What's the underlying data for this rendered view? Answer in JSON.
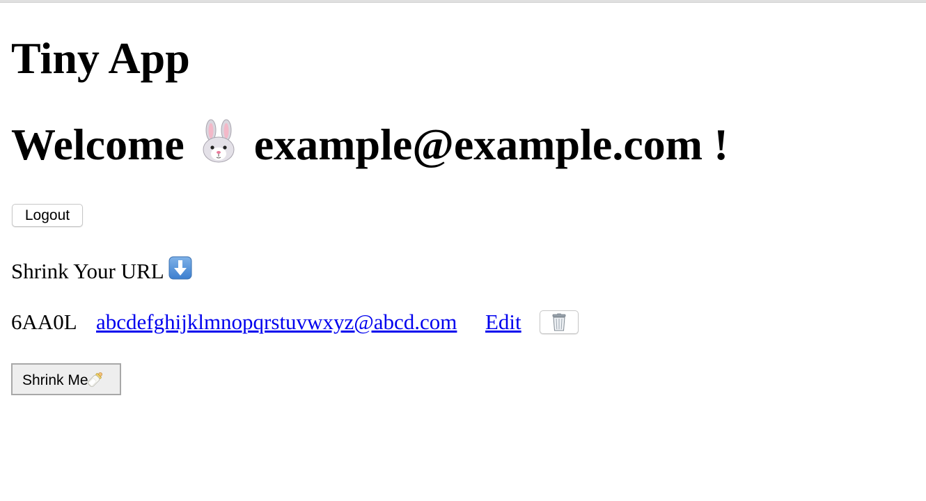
{
  "app": {
    "title": "Tiny App"
  },
  "welcome": {
    "prefix": "Welcome",
    "email": "example@example.com",
    "suffix": "!",
    "icon": "rabbit-face-icon"
  },
  "logout": {
    "label": "Logout"
  },
  "shrink_heading": {
    "label": "Shrink Your URL",
    "icon": "down-arrow-icon"
  },
  "urls": [
    {
      "short_code": "6AA0L",
      "long_url": "abcdefghijklmnopqrstuvwxyz@abcd.com",
      "edit_label": "Edit",
      "delete_icon": "trash-can-icon"
    }
  ],
  "shrink_button": {
    "label": "Shrink Me",
    "icon": "baby-bottle-icon"
  },
  "colors": {
    "link": "#0000ee",
    "text": "#000000",
    "background": "#ffffff"
  }
}
